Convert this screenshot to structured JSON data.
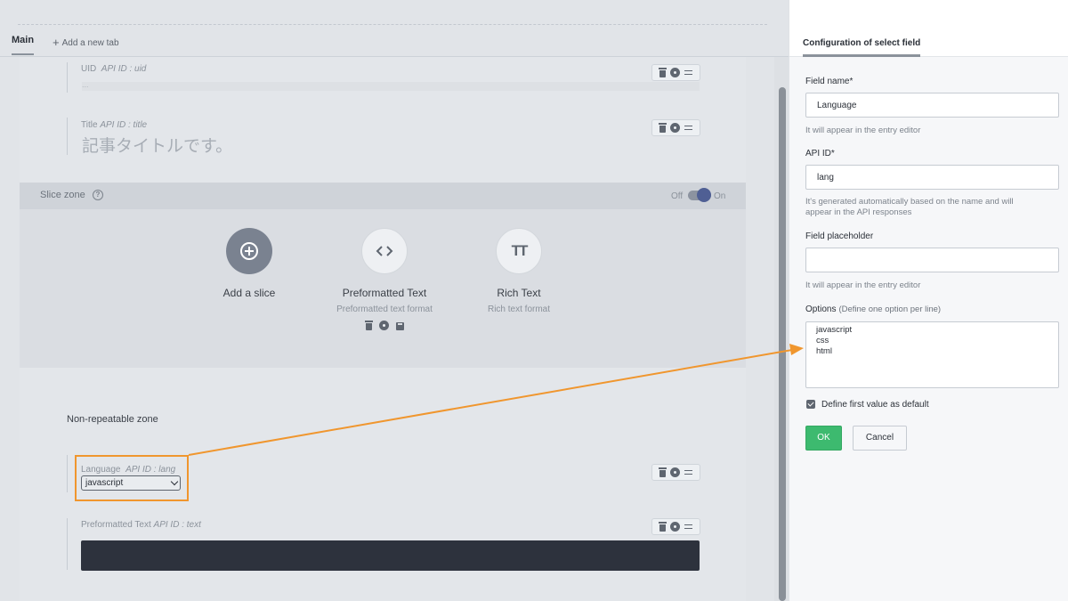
{
  "tabs": {
    "main": "Main",
    "add": "Add a new tab"
  },
  "fields": {
    "uid": {
      "label": "UID",
      "api": "API ID : uid",
      "placeholder": "..."
    },
    "title": {
      "label": "Title",
      "api": "API ID : title",
      "placeholder": "記事タイトルです。"
    },
    "language": {
      "label": "Language",
      "api": "API ID : lang",
      "value": "javascript"
    },
    "text": {
      "label": "Preformatted Text",
      "api": "API ID : text"
    }
  },
  "slice_zone": {
    "title": "Slice zone",
    "help": "?",
    "toggle_off": "Off",
    "toggle_on": "On",
    "items": [
      {
        "name": "Add a slice",
        "desc": "",
        "icon": "plus-circle-icon"
      },
      {
        "name": "Preformatted Text",
        "desc": "Preformatted text format",
        "icon": "code-icon"
      },
      {
        "name": "Rich Text",
        "desc": "Rich text format",
        "icon": "text-format-icon",
        "glyph": "TT"
      }
    ]
  },
  "nonrepeatable": "Non-repeatable zone",
  "panel": {
    "title": "Configuration of select field",
    "field_name_label": "Field name*",
    "field_name_value": "Language",
    "field_name_help": "It will appear in the entry editor",
    "api_id_label": "API ID*",
    "api_id_value": "lang",
    "api_id_help_1": "It's generated automatically based on the name and will",
    "api_id_help_2": "appear in the API responses",
    "placeholder_label": "Field placeholder",
    "placeholder_value": "",
    "placeholder_help": "It will appear in the entry editor",
    "options_label": "Options",
    "options_hint": "(Define one option per line)",
    "options": [
      "javascript",
      "css",
      "html"
    ],
    "default_label": "Define first value as default",
    "default_checked": true,
    "ok": "OK",
    "cancel": "Cancel"
  },
  "colors": {
    "annotation": "#f0962e",
    "ok_button": "#3dba6f",
    "toggle_knob": "#4f5f94"
  }
}
